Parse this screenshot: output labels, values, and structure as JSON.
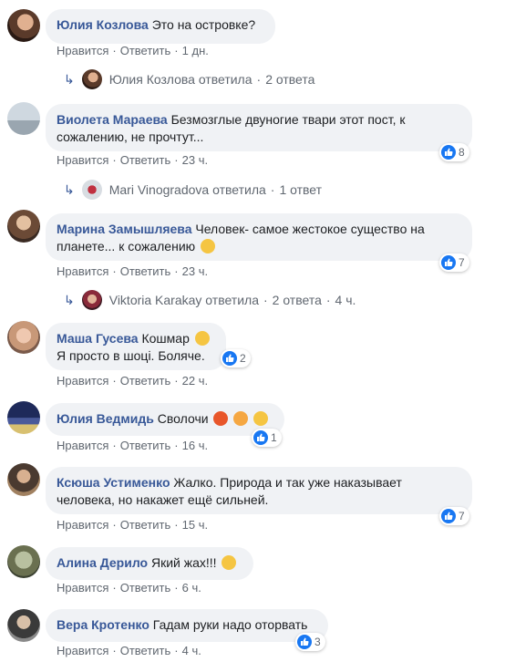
{
  "labels": {
    "like": "Нравится",
    "reply": "Ответить"
  },
  "comments": [
    {
      "author": "Юлия Козлова",
      "text": "Это на островке?",
      "time": "1 дн.",
      "reply_thread": {
        "who": "Юлия Козлова ответила",
        "count": "2 ответа"
      }
    },
    {
      "author": "Виолета Мараева",
      "text": "Безмозглые двуногие твари этот пост, к сожалению, не прочтут...",
      "time": "23 ч.",
      "likes": "8",
      "reply_thread": {
        "who": "Mari Vinogradova ответила",
        "count": "1 ответ"
      }
    },
    {
      "author": "Марина Замышляева",
      "text": "Человек- самое жестокое существо на планете... к сожалению",
      "time": "23 ч.",
      "likes": "7",
      "reply_thread": {
        "who": "Viktoria Karakay ответила",
        "count": "2 ответа",
        "time": "4 ч."
      }
    },
    {
      "author": "Маша Гусева",
      "text": "Кошмар",
      "text2": "Я просто в шоці. Боляче.",
      "time": "22 ч.",
      "likes": "2"
    },
    {
      "author": "Юлия Ведмидь",
      "text": "Сволочи",
      "time": "16 ч.",
      "likes": "1"
    },
    {
      "author": "Ксюша Устименко",
      "text": "Жалко. Природа и так уже наказывает человека, но накажет ещё сильней.",
      "time": "15 ч.",
      "likes": "7"
    },
    {
      "author": "Алина Дерило",
      "text": "Який жах!!!",
      "time": "6 ч."
    },
    {
      "author": "Вера Кротенко",
      "text": "Гадам руки надо оторвать",
      "time": "4 ч.",
      "likes": "3"
    }
  ],
  "colors": {
    "link": "#385898",
    "bubble": "#f0f2f5",
    "like": "#1877f2",
    "meta": "#606770"
  }
}
